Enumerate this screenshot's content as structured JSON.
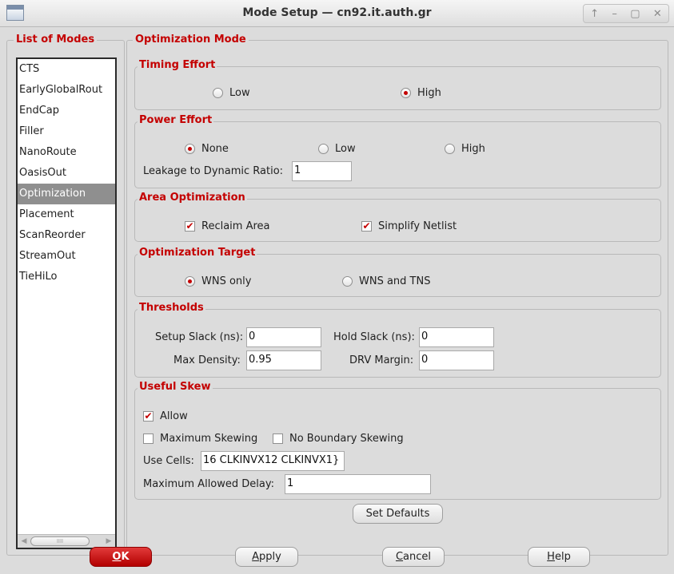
{
  "window": {
    "title": "Mode Setup  — cn92.it.auth.gr",
    "controls": [
      "↑",
      "–",
      "▢",
      "✕"
    ]
  },
  "modes_panel": {
    "title": "List of Modes",
    "items": [
      "CTS",
      "EarlyGlobalRout",
      "EndCap",
      "Filler",
      "NanoRoute",
      "OasisOut",
      "Optimization",
      "Placement",
      "ScanReorder",
      "StreamOut",
      "TieHiLo"
    ],
    "selected": "Optimization",
    "scroll_thumb_grip": "IIII"
  },
  "optimization_mode": {
    "title": "Optimization Mode",
    "timing_effort": {
      "title": "Timing Effort",
      "options": [
        {
          "label": "Low",
          "selected": false
        },
        {
          "label": "High",
          "selected": true
        }
      ]
    },
    "power_effort": {
      "title": "Power Effort",
      "options": [
        {
          "label": "None",
          "selected": true
        },
        {
          "label": "Low",
          "selected": false
        },
        {
          "label": "High",
          "selected": false
        }
      ],
      "leakage_label": "Leakage to Dynamic Ratio:",
      "leakage_value": "1"
    },
    "area_optimization": {
      "title": "Area Optimization",
      "reclaim_area": {
        "label": "Reclaim Area",
        "checked": true
      },
      "simplify_netlist": {
        "label": "Simplify Netlist",
        "checked": true
      }
    },
    "optimization_target": {
      "title": "Optimization Target",
      "options": [
        {
          "label": "WNS only",
          "selected": true
        },
        {
          "label": "WNS and TNS",
          "selected": false
        }
      ]
    },
    "thresholds": {
      "title": "Thresholds",
      "setup_slack_label": "Setup Slack (ns):",
      "setup_slack_value": "0",
      "hold_slack_label": "Hold Slack (ns):",
      "hold_slack_value": "0",
      "max_density_label": "Max Density:",
      "max_density_value": "0.95",
      "drv_margin_label": "DRV Margin:",
      "drv_margin_value": "0"
    },
    "useful_skew": {
      "title": "Useful Skew",
      "allow": {
        "label": "Allow",
        "checked": true
      },
      "maximum_skewing": {
        "label": "Maximum Skewing",
        "checked": false
      },
      "no_boundary_skewing": {
        "label": "No Boundary Skewing",
        "checked": false
      },
      "use_cells_label": "Use Cells:",
      "use_cells_value": "16 CLKINVX12 CLKINVX1}",
      "max_delay_label": "Maximum Allowed Delay:",
      "max_delay_value": "1"
    },
    "set_defaults_label": "Set Defaults"
  },
  "buttons": {
    "ok": {
      "mnemonic": "O",
      "rest": "K"
    },
    "apply": {
      "mnemonic": "A",
      "rest": "pply"
    },
    "cancel": {
      "mnemonic": "C",
      "rest": "ancel"
    },
    "help": {
      "mnemonic": "H",
      "rest": "elp"
    }
  },
  "colors": {
    "accent_red": "#c40000",
    "ok_button": "#c41a1a",
    "background": "#dcdcdc",
    "selected_item": "#8f8f8f"
  },
  "check_glyph": "✔"
}
